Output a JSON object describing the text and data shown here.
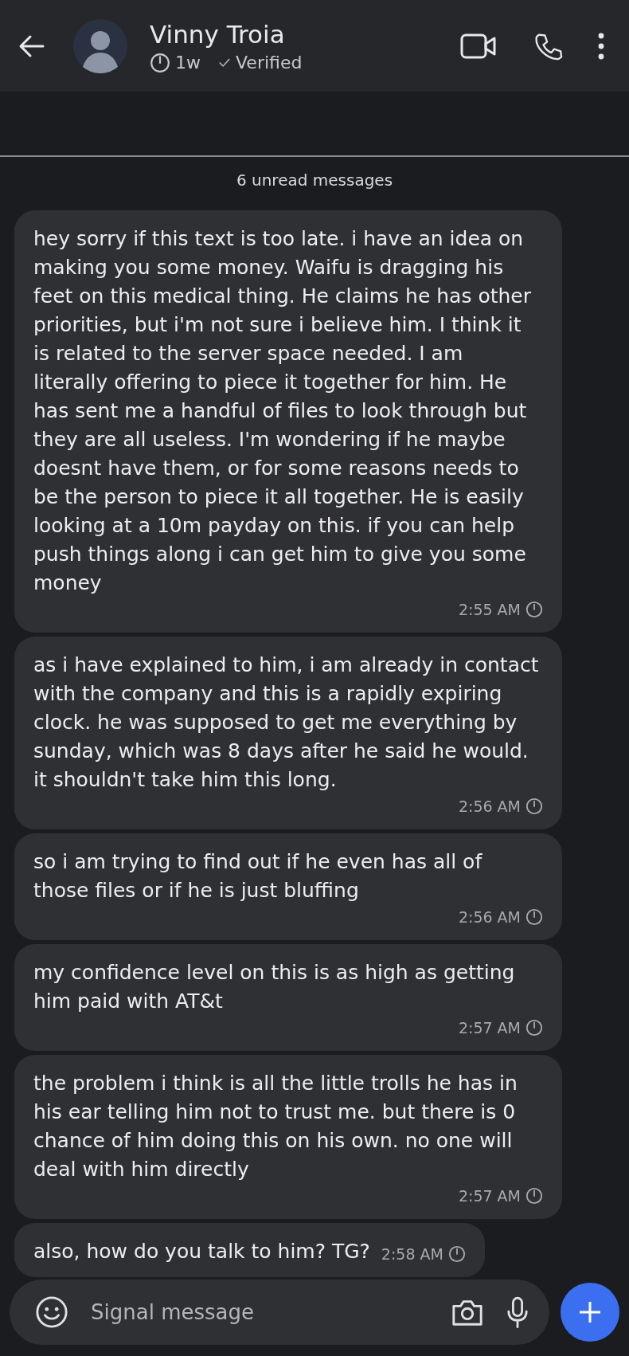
{
  "header": {
    "name": "Vinny Troia",
    "timer": "1w",
    "verified_label": "Verified"
  },
  "unread_banner": "6 unread messages",
  "messages": [
    {
      "text": "hey sorry if this text is too late. i have an idea on making you some money. Waifu is dragging his feet on this medical thing. He claims he has other priorities, but i'm not sure i believe him. I think it is related to the server space needed. I am literally offering to piece it together for him. He has sent me a handful of files to look through but they are all useless. I'm wondering if he maybe doesnt have them, or for some reasons needs to be the person to piece it all together. He is easily looking at a 10m payday on this. if you can help push things along i can get him to give you some money",
      "time": "2:55 AM"
    },
    {
      "text": "as i have explained to him, i am already in contact with the company and this is a rapidly expiring clock. he was supposed to get me everything by sunday, which was 8 days after he said he would. it shouldn't take him this long.",
      "time": "2:56 AM"
    },
    {
      "text": "so i am trying to find out if he even has all of those files or if he is just bluffing",
      "time": "2:56 AM"
    },
    {
      "text": "my confidence level on this is as high as getting him paid with AT&t",
      "time": "2:57 AM"
    },
    {
      "text": "the problem i think is all the little trolls he has in his ear telling him not to trust me. but there is 0 chance of him doing this on his own. no one will deal with him directly",
      "time": "2:57 AM"
    },
    {
      "text": "also, how do you talk to him? TG?",
      "time": "2:58 AM"
    }
  ],
  "composer": {
    "placeholder": "Signal message"
  }
}
